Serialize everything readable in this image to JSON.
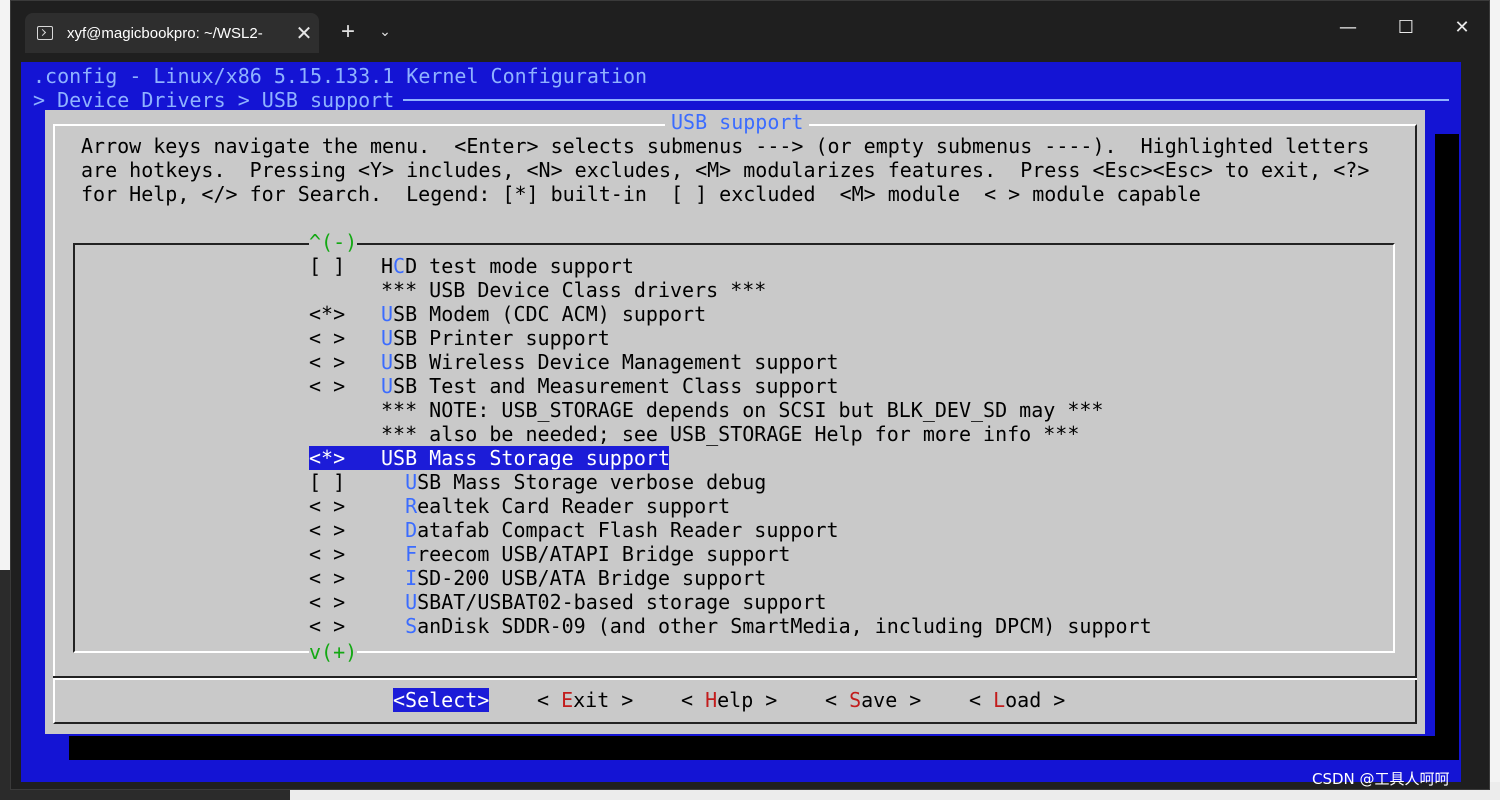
{
  "window": {
    "tab_title": "xyf@magicbookpro: ~/WSL2-",
    "tab_close": "✕",
    "new_tab": "+",
    "dropdown": "⌄",
    "minimize": "—",
    "maximize": "☐",
    "close": "✕"
  },
  "terminal": {
    "header_line1": ".config - Linux/x86 5.15.133.1 Kernel Configuration",
    "header_line2": "> Device Drivers > USB support",
    "dialog_title": "USB support",
    "help_text": "Arrow keys navigate the menu.  <Enter> selects submenus ---> (or empty submenus ----).  Highlighted letters\nare hotkeys.  Pressing <Y> includes, <N> excludes, <M> modularizes features.  Press <Esc><Esc> to exit, <?>\nfor Help, </> for Search.  Legend: [*] built-in  [ ] excluded  <M> module  < > module capable",
    "scroll_up": "^(-)",
    "scroll_down": "v(+)",
    "items": [
      {
        "marker": "[ ]",
        "indent": "",
        "pre": "H",
        "hotkey": "C",
        "rest": "D test mode support"
      },
      {
        "marker": "",
        "indent": "",
        "pre": "",
        "hotkey": "",
        "rest": "*** USB Device Class drivers ***"
      },
      {
        "marker": "<*>",
        "indent": "",
        "pre": "",
        "hotkey": "U",
        "rest": "SB Modem (CDC ACM) support"
      },
      {
        "marker": "< >",
        "indent": "",
        "pre": "",
        "hotkey": "U",
        "rest": "SB Printer support"
      },
      {
        "marker": "< >",
        "indent": "",
        "pre": "",
        "hotkey": "U",
        "rest": "SB Wireless Device Management support"
      },
      {
        "marker": "< >",
        "indent": "",
        "pre": "",
        "hotkey": "U",
        "rest": "SB Test and Measurement Class support"
      },
      {
        "marker": "",
        "indent": "",
        "pre": "",
        "hotkey": "",
        "rest": "*** NOTE: USB_STORAGE depends on SCSI but BLK_DEV_SD may ***"
      },
      {
        "marker": "",
        "indent": "",
        "pre": "",
        "hotkey": "",
        "rest": "*** also be needed; see USB_STORAGE Help for more info ***"
      },
      {
        "marker": "<*>",
        "indent": "",
        "pre": "",
        "hotkey": "",
        "rest": "USB Mass Storage support",
        "selected": true
      },
      {
        "marker": "[ ]",
        "indent": "  ",
        "pre": "",
        "hotkey": "U",
        "rest": "SB Mass Storage verbose debug"
      },
      {
        "marker": "< >",
        "indent": "  ",
        "pre": "",
        "hotkey": "R",
        "rest": "ealtek Card Reader support"
      },
      {
        "marker": "< >",
        "indent": "  ",
        "pre": "",
        "hotkey": "D",
        "rest": "atafab Compact Flash Reader support"
      },
      {
        "marker": "< >",
        "indent": "  ",
        "pre": "",
        "hotkey": "F",
        "rest": "reecom USB/ATAPI Bridge support"
      },
      {
        "marker": "< >",
        "indent": "  ",
        "pre": "",
        "hotkey": "I",
        "rest": "SD-200 USB/ATA Bridge support"
      },
      {
        "marker": "< >",
        "indent": "  ",
        "pre": "",
        "hotkey": "U",
        "rest": "SBAT/USBAT02-based storage support"
      },
      {
        "marker": "< >",
        "indent": "  ",
        "pre": "",
        "hotkey": "S",
        "rest": "anDisk SDDR-09 (and other SmartMedia, including DPCM) support"
      }
    ],
    "buttons": {
      "select": "<Select>",
      "exit": {
        "pre": "< ",
        "hotkey": "E",
        "rest": "xit >"
      },
      "help": {
        "pre": "< ",
        "hotkey": "H",
        "rest": "elp >"
      },
      "save": {
        "pre": "< ",
        "hotkey": "S",
        "rest": "ave >"
      },
      "load": {
        "pre": "< ",
        "hotkey": "L",
        "rest": "oad >"
      }
    }
  },
  "watermark": "CSDN @工具人呵呵",
  "colors": {
    "terminal_bg": "#1414d4",
    "dialog_bg": "#c9c9c9",
    "hotkey": "#3b6cff",
    "button_hotkey": "#c21c1c",
    "scroll_indicator": "#13a813",
    "selection_bg": "#1c1cd8"
  }
}
